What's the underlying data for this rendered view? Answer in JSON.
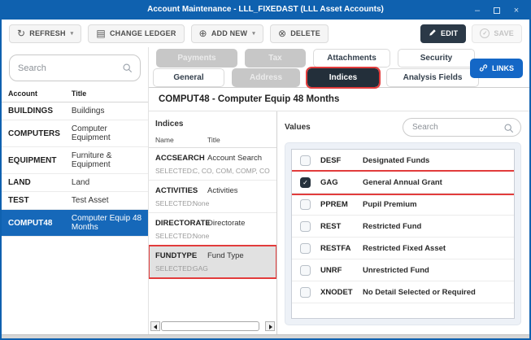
{
  "window": {
    "title": "Account Maintenance - LLL_FIXEDAST (LLL Asset Accounts)",
    "minimize_glyph": "–",
    "close_glyph": "×"
  },
  "toolbar": {
    "refresh_label": "REFRESH",
    "change_ledger_label": "CHANGE LEDGER",
    "add_new_label": "ADD NEW",
    "delete_label": "DELETE",
    "edit_label": "EDIT",
    "save_label": "SAVE",
    "refresh_icon": "↻",
    "ledger_icon": "▤",
    "add_icon": "⊕",
    "delete_icon": "⊗",
    "save_icon": "✓",
    "chevron_glyph": "▾"
  },
  "accounts": {
    "search_placeholder": "Search",
    "columns": [
      "Account",
      "Title"
    ],
    "rows": [
      {
        "account": "BUILDINGS",
        "title": "Buildings",
        "selected": false
      },
      {
        "account": "COMPUTERS",
        "title": "Computer Equipment",
        "selected": false
      },
      {
        "account": "EQUIPMENT",
        "title": "Furniture & Equipment",
        "selected": false
      },
      {
        "account": "LAND",
        "title": "Land",
        "selected": false
      },
      {
        "account": "TEST",
        "title": "Test Asset",
        "selected": false
      },
      {
        "account": "COMPUT48",
        "title": "Computer Equip 48 Months",
        "selected": true
      }
    ]
  },
  "tabs": {
    "row1": [
      {
        "label": "Payments",
        "state": "disabled"
      },
      {
        "label": "Tax",
        "state": "disabled"
      },
      {
        "label": "Attachments",
        "state": "normal"
      },
      {
        "label": "Security",
        "state": "normal"
      }
    ],
    "row2": [
      {
        "label": "General",
        "state": "normal"
      },
      {
        "label": "Address",
        "state": "disabled"
      },
      {
        "label": "Indices",
        "state": "active"
      },
      {
        "label": "Analysis Fields",
        "state": "normal"
      }
    ],
    "links_label": "LINKS"
  },
  "content": {
    "header": "COMPUT48 - Computer Equip 48 Months",
    "indices": {
      "label": "Indices",
      "columns": [
        "Name",
        "Title"
      ],
      "selected_label": "SELECTED:",
      "rows": [
        {
          "name": "ACCSEARCH",
          "title": "Account Search",
          "selected_values": "C, CO, COM, COMP, COMPU, CO",
          "highlighted": false
        },
        {
          "name": "ACTIVITIES",
          "title": "Activities",
          "selected_values": "None",
          "highlighted": false
        },
        {
          "name": "DIRECTORATE",
          "title": "Directorate",
          "selected_values": "None",
          "highlighted": false
        },
        {
          "name": "FUNDTYPE",
          "title": "Fund Type",
          "selected_values": "GAG",
          "highlighted": true
        }
      ]
    },
    "values": {
      "label": "Values",
      "search_placeholder": "Search",
      "rows": [
        {
          "code": "DESF",
          "title": "Designated Funds",
          "checked": false,
          "highlighted": false
        },
        {
          "code": "GAG",
          "title": "General Annual Grant",
          "checked": true,
          "highlighted": true
        },
        {
          "code": "PPREM",
          "title": "Pupil Premium",
          "checked": false,
          "highlighted": false
        },
        {
          "code": "REST",
          "title": "Restricted Fund",
          "checked": false,
          "highlighted": false
        },
        {
          "code": "RESTFA",
          "title": "Restricted Fixed Asset",
          "checked": false,
          "highlighted": false
        },
        {
          "code": "UNRF",
          "title": "Unrestricted Fund",
          "checked": false,
          "highlighted": false
        },
        {
          "code": "XNODET",
          "title": "No Detail Selected or Required",
          "checked": false,
          "highlighted": false
        }
      ]
    }
  },
  "icons": {
    "check": "✓"
  },
  "colors": {
    "titlebar_blue": "#0f61af",
    "selected_row_blue": "#1668b9",
    "dark_navy": "#26323d",
    "highlight_red": "#e23c3c",
    "links_blue": "#1467c6",
    "disabled_tab_gray": "#c7c7c7"
  }
}
